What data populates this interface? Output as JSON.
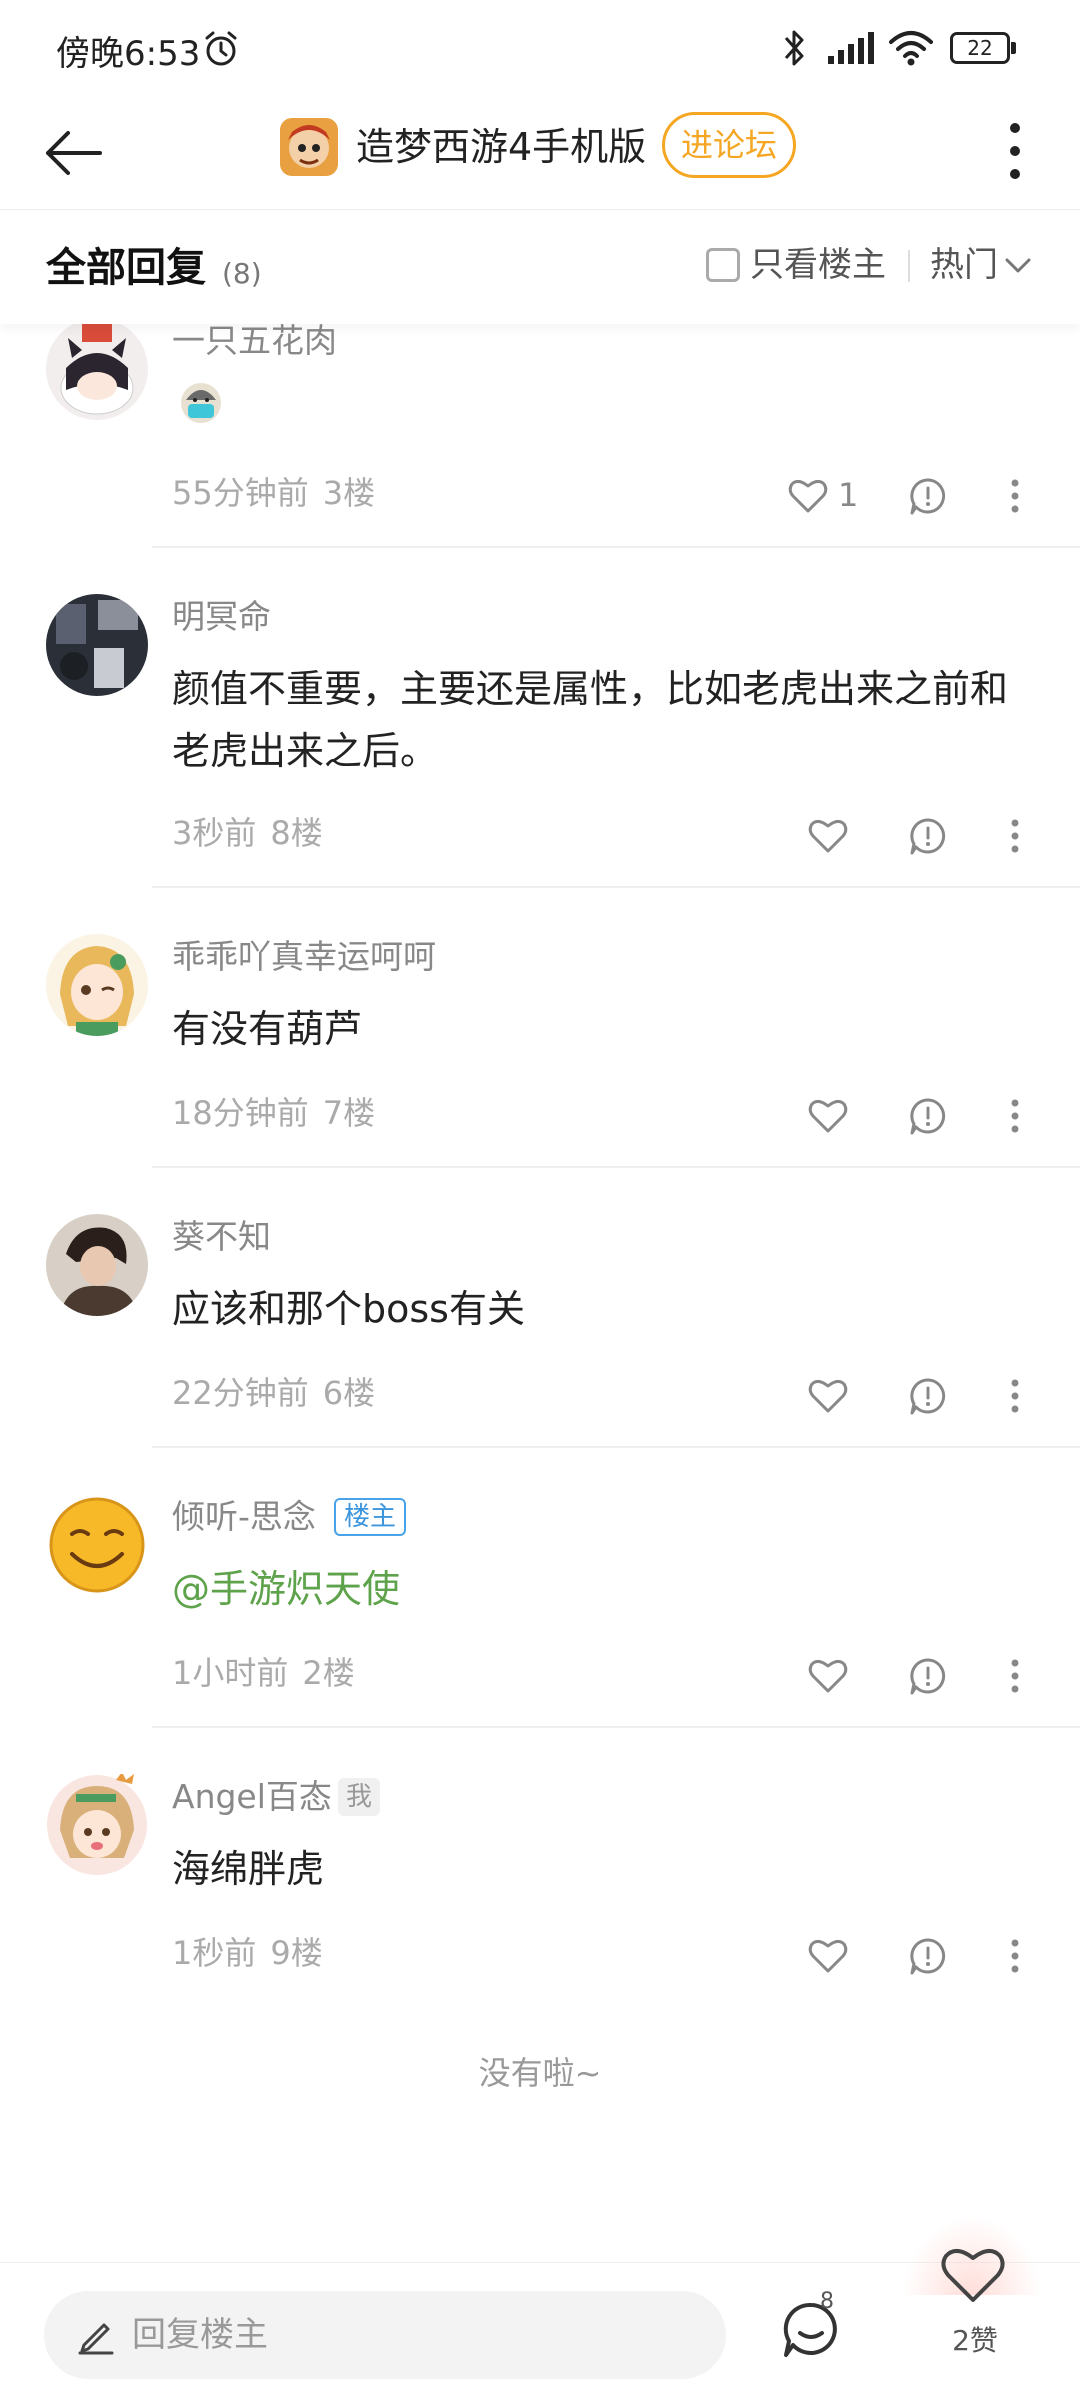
{
  "status": {
    "time": "傍晚6:53",
    "battery": "22"
  },
  "header": {
    "forum_name": "造梦西游4手机版",
    "enter_label": "进论坛"
  },
  "replies": {
    "title": "全部回复",
    "count": "(8)",
    "op_only": "只看楼主",
    "sort": "热门"
  },
  "comments": [
    {
      "user": "一只五花肉",
      "text": "",
      "time": "55分钟前",
      "floor": "3楼",
      "likes": "1"
    },
    {
      "user": "明冥命",
      "text": "颜值不重要，主要还是属性，比如老虎出来之前和老虎出来之后。",
      "time": "3秒前",
      "floor": "8楼",
      "likes": ""
    },
    {
      "user": "乖乖吖真幸运呵呵",
      "text": "有没有葫芦",
      "time": "18分钟前",
      "floor": "7楼",
      "likes": ""
    },
    {
      "user": "葵不知",
      "text": "应该和那个boss有关",
      "time": "22分钟前",
      "floor": "6楼",
      "likes": ""
    },
    {
      "user": "倾听-思念",
      "badge": "楼主",
      "text": "@手游炽天使",
      "time": "1小时前",
      "floor": "2楼",
      "likes": ""
    },
    {
      "user": "Angel百态",
      "badge": "我",
      "text": "海绵胖虎",
      "time": "1秒前",
      "floor": "9楼",
      "likes": ""
    }
  ],
  "end_text": "没有啦~",
  "bottom": {
    "reply_placeholder": "回复楼主",
    "comment_badge": "8",
    "likes_label": "2赞"
  },
  "colors": {
    "accent": "#f5a623",
    "link": "#5ea34b",
    "op_badge": "#3d96dd"
  }
}
